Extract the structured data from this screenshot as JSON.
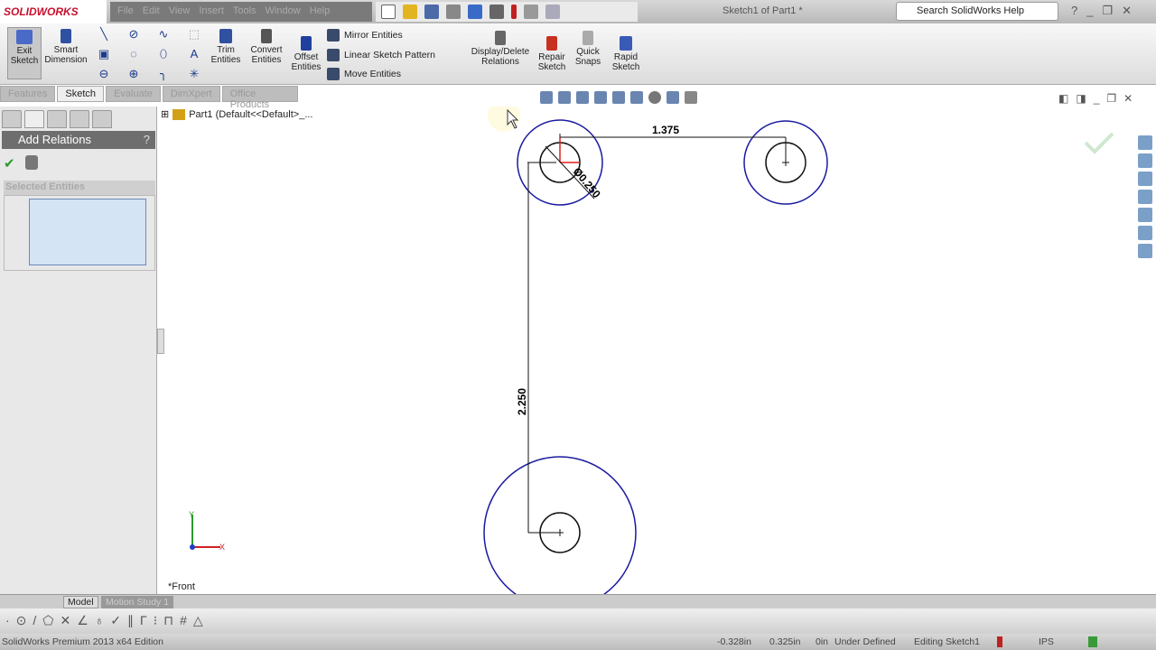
{
  "app": {
    "logo": "SOLIDWORKS",
    "title": "Sketch1 of Part1 *"
  },
  "menu": [
    "File",
    "Edit",
    "View",
    "Insert",
    "Tools",
    "Window",
    "Help"
  ],
  "search": {
    "placeholder": "Search SolidWorks Help"
  },
  "ribbon": {
    "exit_sketch": "Exit Sketch",
    "smart_dimension": "Smart Dimension",
    "trim": "Trim Entities",
    "convert": "Convert Entities",
    "offset": "Offset Entities",
    "mirror": "Mirror Entities",
    "linear_pattern": "Linear Sketch Pattern",
    "move": "Move Entities",
    "display_delete": "Display/Delete Relations",
    "repair": "Repair Sketch",
    "quick_snaps": "Quick Snaps",
    "rapid": "Rapid Sketch"
  },
  "tabs": [
    {
      "label": "Features"
    },
    {
      "label": "Sketch"
    },
    {
      "label": "Evaluate"
    },
    {
      "label": "DimXpert"
    },
    {
      "label": "Office Products"
    }
  ],
  "panel": {
    "title": "Add Relations",
    "help": "?",
    "selected_section": "Selected Entities"
  },
  "tree": {
    "root": "Part1  (Default<<Default>_..."
  },
  "sketch": {
    "dim_horizontal": "1.375",
    "dim_vertical": "2.250",
    "dim_diameter": "Ø0.250",
    "colors": {
      "outer": "#1a1aa0",
      "inner": "#111111",
      "relation": "#e02020"
    }
  },
  "view": {
    "name": "*Front"
  },
  "bottom_tabs": [
    "Model",
    "Motion Study 1"
  ],
  "status": {
    "edition": "SolidWorks Premium 2013 x64 Edition",
    "x": "-0.328in",
    "y": "0.325in",
    "z": "0in",
    "state": "Under Defined",
    "mode": "Editing Sketch1",
    "units": "IPS"
  }
}
